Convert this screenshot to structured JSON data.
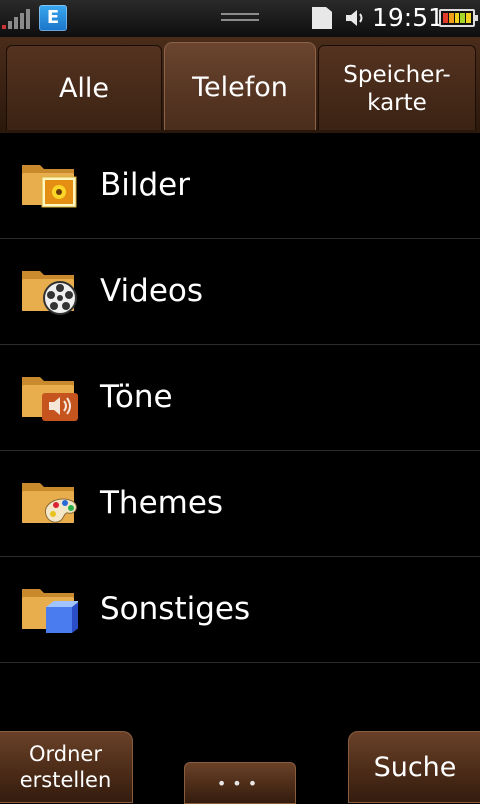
{
  "status_bar": {
    "network_badge": "E",
    "time": "19:51",
    "icons": [
      "signal-bars-icon",
      "sd-card-icon",
      "speaker-icon",
      "battery-icon"
    ]
  },
  "tabs": [
    {
      "label": "Alle",
      "selected": false
    },
    {
      "label": "Telefon",
      "selected": true
    },
    {
      "label": "Speicher-\nkarte",
      "selected": false
    }
  ],
  "folders": [
    {
      "label": "Bilder",
      "icon": "folder-pictures-icon"
    },
    {
      "label": "Videos",
      "icon": "folder-videos-icon"
    },
    {
      "label": "Töne",
      "icon": "folder-sounds-icon"
    },
    {
      "label": "Themes",
      "icon": "folder-themes-icon"
    },
    {
      "label": "Sonstiges",
      "icon": "folder-other-icon"
    }
  ],
  "bottom_bar": {
    "left_button": "Ordner\nerstellen",
    "middle_button": "•••",
    "right_button": "Suche"
  },
  "colors": {
    "tab_wood": "#3b2213",
    "folder": "#e5a84a",
    "battery_segments": [
      "#e23b2a",
      "#f2a019",
      "#f2d21e",
      "#a6d62a",
      "#f2d21e"
    ]
  }
}
